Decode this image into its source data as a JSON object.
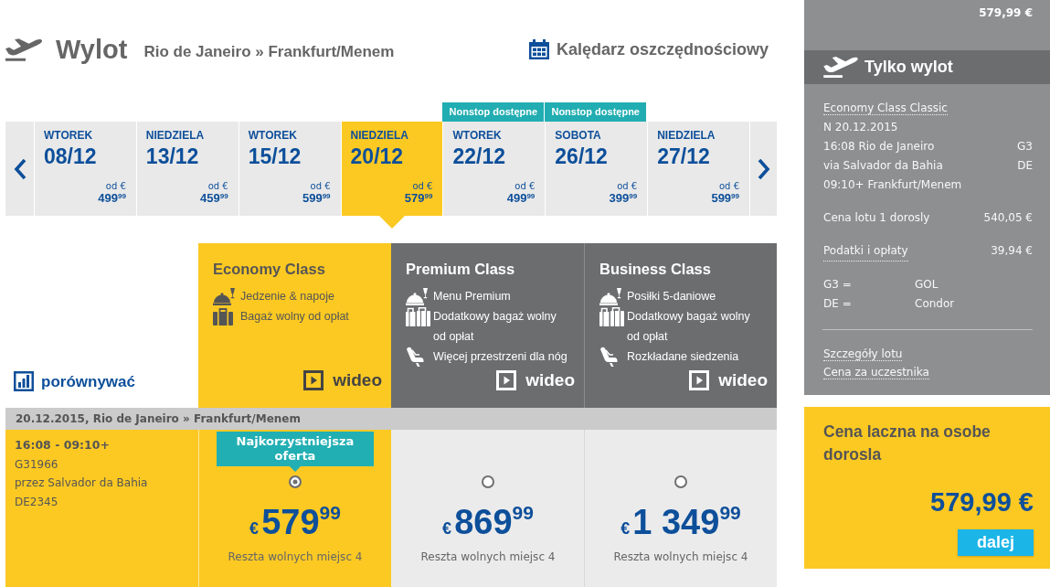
{
  "header": {
    "title": "Wylot",
    "route": "Rio de Janeiro » Frankfurt/Menem",
    "calendar_link": "Kalędarz oszczędnościowy"
  },
  "date_strip": {
    "days": [
      {
        "weekday": "WTOREK",
        "date": "08/12",
        "from_label": "od €",
        "price": "499$^{99}$",
        "selected": false
      },
      {
        "weekday": "NIEDZIELA",
        "date": "13/12",
        "from_label": "od €",
        "price": "459$^{99}$",
        "selected": false
      },
      {
        "weekday": "WTOREK",
        "date": "15/12",
        "from_label": "od €",
        "price": "599$^{99}$",
        "selected": false
      },
      {
        "weekday": "NIEDZIELA",
        "date": "20/12",
        "from_label": "od €",
        "price": "579$^{99}$",
        "selected": true
      },
      {
        "weekday": "WTOREK",
        "date": "22/12",
        "from_label": "od €",
        "price": "499$^{99}$",
        "selected": false,
        "badge": "Nonstop dostępne"
      },
      {
        "weekday": "SOBOTA",
        "date": "26/12",
        "from_label": "od €",
        "price": "399$^{99}$",
        "selected": false,
        "badge": "Nonstop dostępne"
      },
      {
        "weekday": "NIEDZIELA",
        "date": "27/12",
        "from_label": "od €",
        "price": "599$^{99}$",
        "selected": false
      }
    ]
  },
  "compare_link": "porównywać",
  "classes": [
    {
      "name": "Economy Class",
      "selected": true,
      "features": [
        {
          "kind": "meal",
          "text": "Jedzenie & napoje"
        },
        {
          "kind": "baggage",
          "text": "Bagaż wolny od opłat"
        }
      ],
      "video_label": "wideo"
    },
    {
      "name": "Premium Class",
      "selected": false,
      "features": [
        {
          "kind": "meal",
          "text": "Menu Premium"
        },
        {
          "kind": "extra_baggage",
          "text": "Dodatkowy bagaż wolny od opłat"
        },
        {
          "kind": "seat",
          "text": "Więcej przestrzeni dla nóg"
        }
      ],
      "video_label": "wideo"
    },
    {
      "name": "Business Class",
      "selected": false,
      "features": [
        {
          "kind": "meal",
          "text": "Posiłki 5-daniowe"
        },
        {
          "kind": "extra_baggage",
          "text": "Dodatkowy bagaż wolny od opłat"
        },
        {
          "kind": "seat",
          "text": "Rozkładane siedzenia"
        }
      ],
      "video_label": "wideo"
    }
  ],
  "flight": {
    "date_route": "20.12.2015, Rio de Janeiro » Frankfurt/Menem",
    "times": "16:08 - 09:10+",
    "lines": [
      "G31966",
      "przez Salvador da Bahia",
      "DE2345"
    ],
    "fares": [
      {
        "badge": "Najkorzystniejsza oferta",
        "selected": true,
        "currency": "€",
        "price": "579$^{99}$",
        "seats": "Reszta wolnych miejsc 4"
      },
      {
        "selected": false,
        "currency": "€",
        "price": "869$^{99}$",
        "seats": "Reszta wolnych miejsc 4"
      },
      {
        "selected": false,
        "currency": "€",
        "price": "1 349$^{99}$",
        "seats": "Reszta wolnych miejsc 4"
      }
    ]
  },
  "summary": {
    "top_total": "579,99 €",
    "title": "Tylko wylot",
    "fare_name": "Economy Class Classic",
    "date": "N 20.12.2015",
    "segments": [
      {
        "text": "16:08 Rio de Janeiro",
        "code": "G3"
      },
      {
        "text": "via Salvador da Bahia",
        "code": "DE"
      },
      {
        "text": "09:10+ Frankfurt/Menem"
      }
    ],
    "price_rows": [
      {
        "kind": "text",
        "label": "Cena lotu 1 dorosly",
        "value": "540,05 €"
      },
      {
        "kind": "link",
        "label": "Podatki i opłaty",
        "value": "39,94 €"
      }
    ],
    "carriers": [
      {
        "code": "G3 =",
        "name": "GOL"
      },
      {
        "code": "DE =",
        "name": "Condor"
      }
    ],
    "links": [
      "Szczegóły lotu",
      "Cena za uczestnika"
    ]
  },
  "total": {
    "label": "Cena laczna na osobe dorosla",
    "price": "579,99 €",
    "button": "dalej"
  }
}
